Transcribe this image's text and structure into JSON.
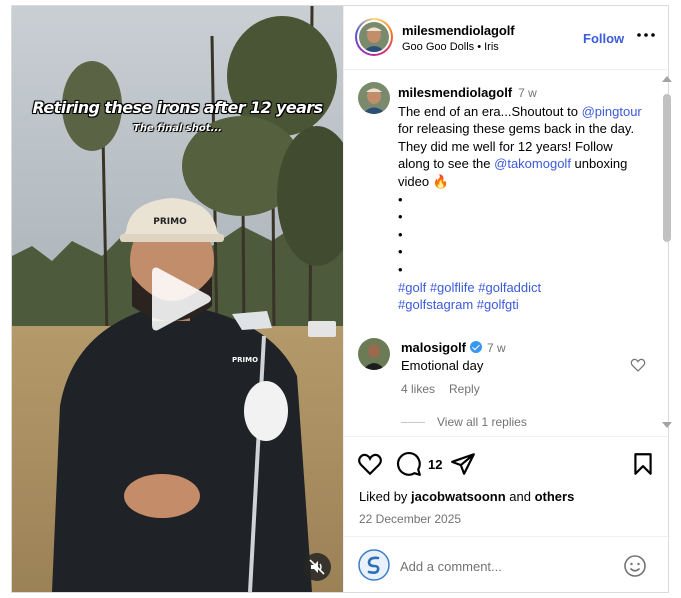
{
  "video": {
    "overlay_title": "Retiring these irons after 12 years",
    "overlay_subtitle": "The final shot...",
    "play_icon": "play-icon",
    "mute_icon": "speaker-muted-icon"
  },
  "post": {
    "author": "milesmendiolagolf",
    "music": "Goo Goo Dolls • Iris",
    "follow_label": "Follow",
    "more_icon": "more-horizontal-icon"
  },
  "caption": {
    "username": "milesmendiolagolf",
    "time": "7 w",
    "text_before_mention": "The end of an era...Shoutout to ",
    "mention_1": "@pingtour",
    "text_middle": " for releasing these gems back in the day. They did me well for 12 years! Follow along to see the ",
    "mention_2": "@takomogolf",
    "text_after": " unboxing video 🔥",
    "dots": [
      "•",
      "•",
      "•",
      "•",
      "•"
    ],
    "hashtags": [
      "#golf",
      "#golflife",
      "#golfaddict",
      "#golfstagram",
      "#golfgti"
    ]
  },
  "comment": {
    "username": "malosigolf",
    "time": "7 w",
    "text": "Emotional day",
    "likes": "4 likes",
    "reply_label": "Reply",
    "view_replies": "View all 1 replies"
  },
  "actions": {
    "comment_count": "12",
    "liked_by_prefix": "Liked by ",
    "liked_by_user": "jacobwatsoonn",
    "liked_by_and": " and ",
    "liked_by_others": "others",
    "date": "22 December 2025"
  },
  "add_comment": {
    "placeholder": "Add a comment..."
  },
  "colors": {
    "link_blue": "#3b5bdb",
    "muted_gray": "#737373",
    "verified_blue": "#3897f0"
  }
}
